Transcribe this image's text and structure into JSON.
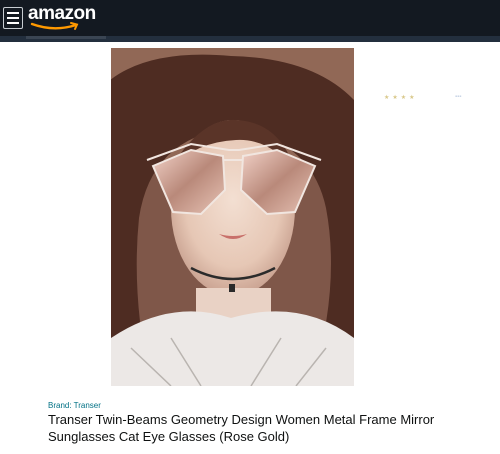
{
  "header": {
    "logo_text": "amazon",
    "menu_icon": "hamburger-menu-icon",
    "background": "#131921"
  },
  "product": {
    "brand_label": "Brand: Transer",
    "title": "Transer Twin-Beams Geometry Design Women Metal Frame Mirror Sunglasses Cat Eye Glasses (Rose Gold)",
    "image": "product-photo-woman-wearing-rose-gold-geometric-sunglasses",
    "brand_color": "#007185"
  }
}
